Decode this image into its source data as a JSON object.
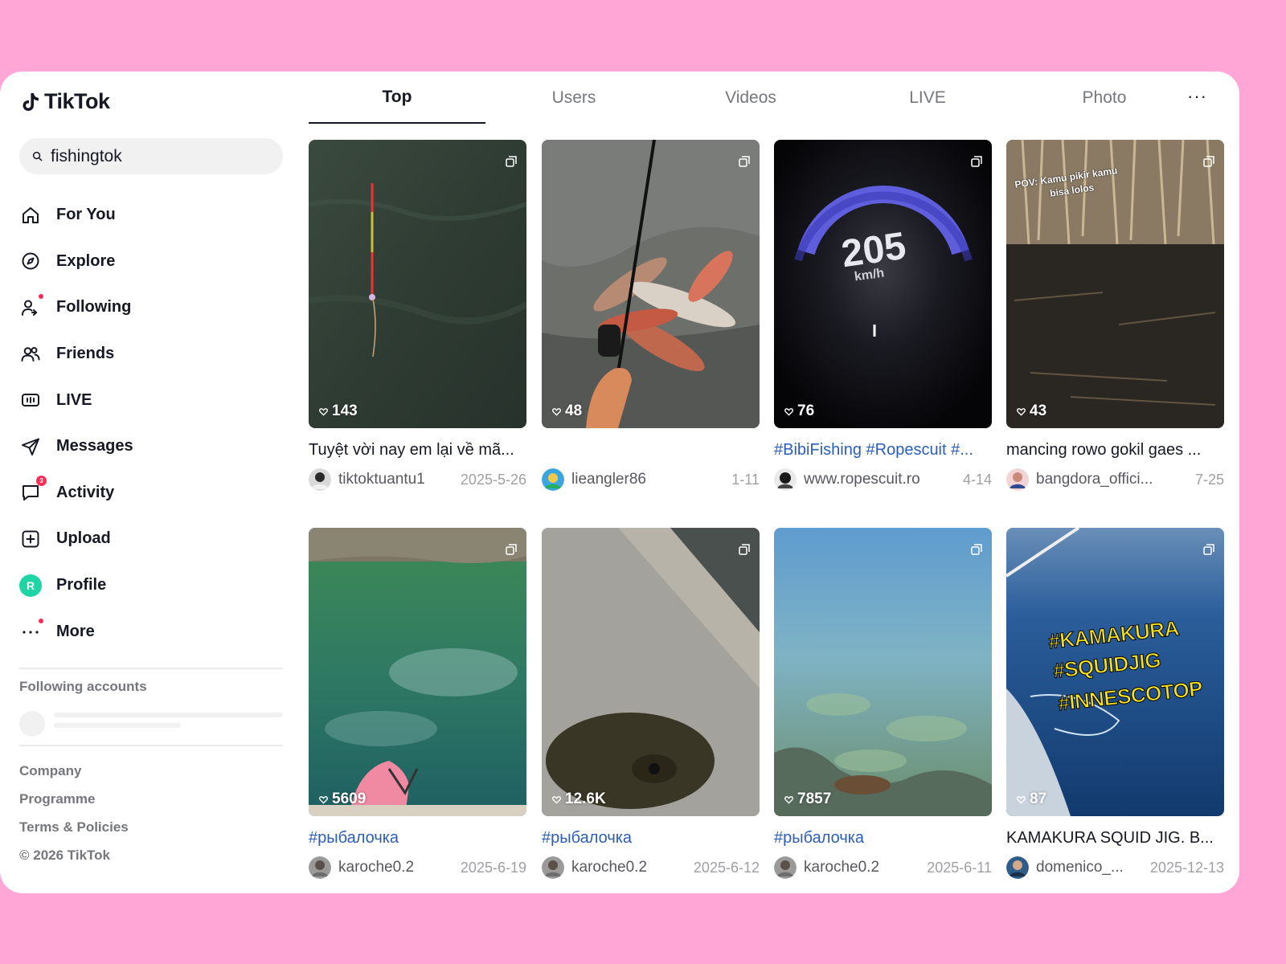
{
  "app": {
    "name": "TikTok"
  },
  "search": {
    "query": "fishingtok"
  },
  "nav": [
    {
      "label": "For You",
      "icon": "home-icon"
    },
    {
      "label": "Explore",
      "icon": "compass-icon"
    },
    {
      "label": "Following",
      "icon": "following-icon"
    },
    {
      "label": "Friends",
      "icon": "friends-icon"
    },
    {
      "label": "LIVE",
      "icon": "live-icon"
    },
    {
      "label": "Messages",
      "icon": "send-icon"
    },
    {
      "label": "Activity",
      "icon": "activity-icon",
      "badge": "3"
    },
    {
      "label": "Upload",
      "icon": "upload-icon"
    },
    {
      "label": "Profile",
      "icon": "avatar",
      "avatar_letter": "R"
    },
    {
      "label": "More",
      "icon": "more-icon"
    }
  ],
  "following_accounts": {
    "title": "Following accounts"
  },
  "footer": [
    "Company",
    "Programme",
    "Terms & Policies",
    "© 2026 TikTok"
  ],
  "tabs": [
    "Top",
    "Users",
    "Videos",
    "LIVE",
    "Photo"
  ],
  "more_tab": "···",
  "colors": {
    "accent": "#fe2c55",
    "hashtag": "#2b5db9",
    "background": "#ffa6d6"
  },
  "videos": [
    {
      "likes": "143",
      "caption": "Tuyệt vời nay em lại về mã...",
      "user": "tiktoktuantu1",
      "date": "2025-5-26"
    },
    {
      "likes": "48",
      "caption": "",
      "user": "lieangler86",
      "date": "1-11"
    },
    {
      "likes": "76",
      "caption": "#BibiFishing #Ropescuit #...",
      "user": "www.ropescuit.ro",
      "date": "4-14",
      "overlay": "205",
      "overlay_sub": "km/h"
    },
    {
      "likes": "43",
      "caption": "mancing rowo gokil gaes ...",
      "user": "bangdora_offici...",
      "date": "7-25",
      "overlay": "POV: Kamu pikir kamu",
      "overlay2": "bisa lolos"
    },
    {
      "likes": "5609",
      "caption": "#рыбалочка",
      "user": "karoche0.2",
      "date": "2025-6-19"
    },
    {
      "likes": "12.6K",
      "caption": "#рыбалочка",
      "user": "karoche0.2",
      "date": "2025-6-12"
    },
    {
      "likes": "7857",
      "caption": "#рыбалочка",
      "user": "karoche0.2",
      "date": "2025-6-11"
    },
    {
      "likes": "87",
      "caption": "KAMAKURA SQUID JIG. B...",
      "user": "domenico_...",
      "date": "2025-12-13",
      "overlay": "#KAMAKURA",
      "overlay2": "#SQUIDJIG",
      "overlay3": "#INNESCOTOP"
    }
  ]
}
